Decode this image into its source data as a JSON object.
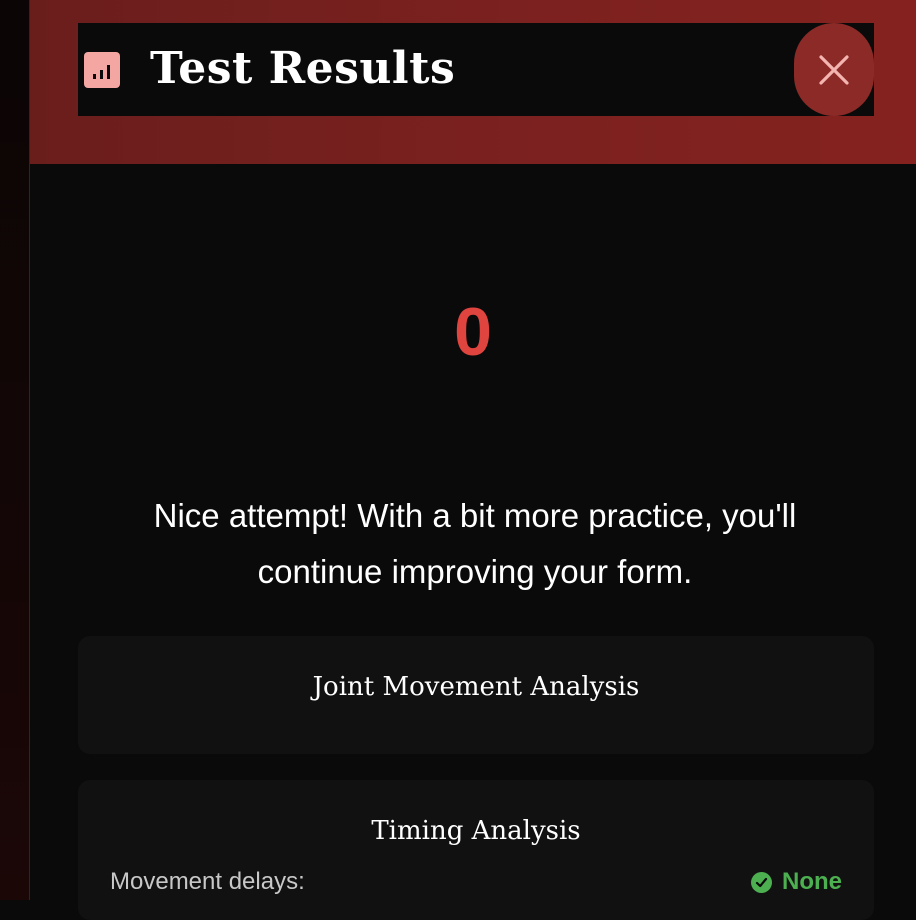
{
  "header": {
    "title": "Test Results",
    "icon": "bar-chart-icon",
    "close_icon": "close-icon"
  },
  "result": {
    "score": "0",
    "message": "Nice attempt! With a bit more practice, you'll continue improving your form."
  },
  "sections": {
    "joint": {
      "title": "Joint Movement Analysis"
    },
    "timing": {
      "title": "Timing Analysis",
      "rows": [
        {
          "label": "Movement delays:",
          "value": "None",
          "status_icon": "check-circle-icon"
        }
      ]
    }
  },
  "colors": {
    "accent": "#e0443e",
    "header_red": "#7a211f",
    "close_button": "#8c2a27",
    "success": "#4caf50",
    "icon_pink": "#f4a6a2"
  }
}
